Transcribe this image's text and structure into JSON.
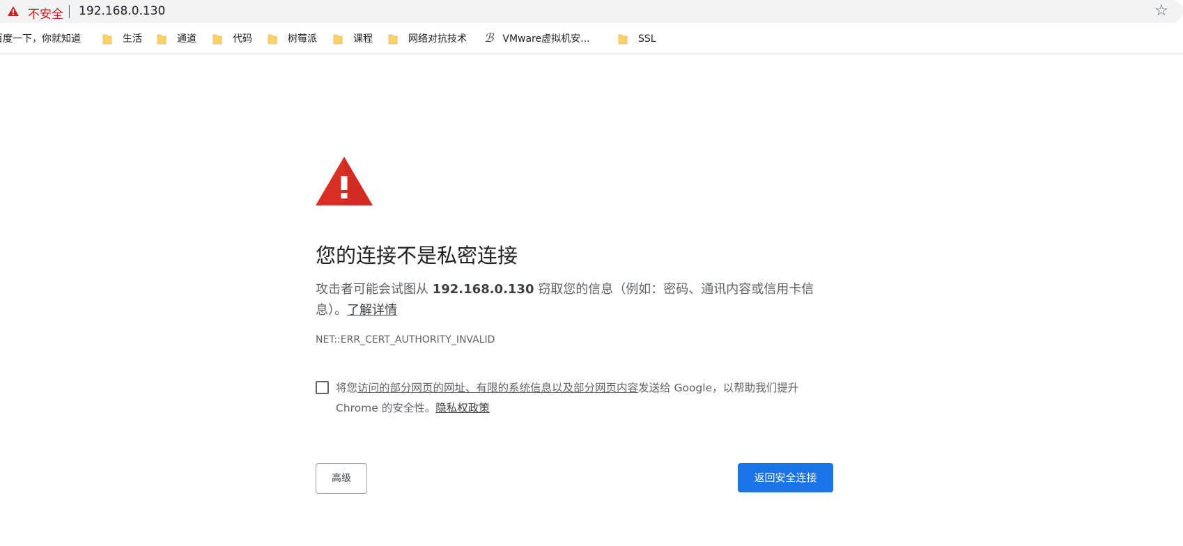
{
  "omnibox": {
    "security_label": "不安全",
    "url": "192.168.0.130",
    "star_glyph": "☆",
    "warn_color": "#c5221f"
  },
  "bookmarks": [
    {
      "label": "百度一下，你就知道",
      "icon": "none"
    },
    {
      "label": "生活",
      "icon": "folder-icon"
    },
    {
      "label": "通道",
      "icon": "folder-icon"
    },
    {
      "label": "代码",
      "icon": "folder-icon"
    },
    {
      "label": "树莓派",
      "icon": "folder-icon"
    },
    {
      "label": "课程",
      "icon": "folder-icon"
    },
    {
      "label": "网络对抗技术",
      "icon": "folder-icon"
    },
    {
      "label": "VMware虚拟机安...",
      "icon": "vmware-icon"
    },
    {
      "label": "SSL",
      "icon": "folder-icon"
    }
  ],
  "interstitial": {
    "icon": "warning-triangle-icon",
    "icon_color": "#d93025",
    "title": "您的连接不是私密连接",
    "desc_prefix": "攻击者可能会试图从 ",
    "desc_host": "192.168.0.130",
    "desc_suffix": " 窃取您的信息（例如：密码、通讯内容或信用卡信息）。",
    "learn_more": "了解详情",
    "error_code": "NET::ERR_CERT_AUTHORITY_INVALID",
    "optin_prefix": "将您",
    "optin_link": "访问的部分网页的网址、有限的系统信息以及部分网页内容",
    "optin_suffix": "发送给 Google，以帮助我们提升 Chrome 的安全性。",
    "privacy_link": "隐私权政策",
    "optin_checked": false,
    "advanced_button": "高级",
    "back_button": "返回安全连接",
    "primary_color": "#1a73e8"
  }
}
